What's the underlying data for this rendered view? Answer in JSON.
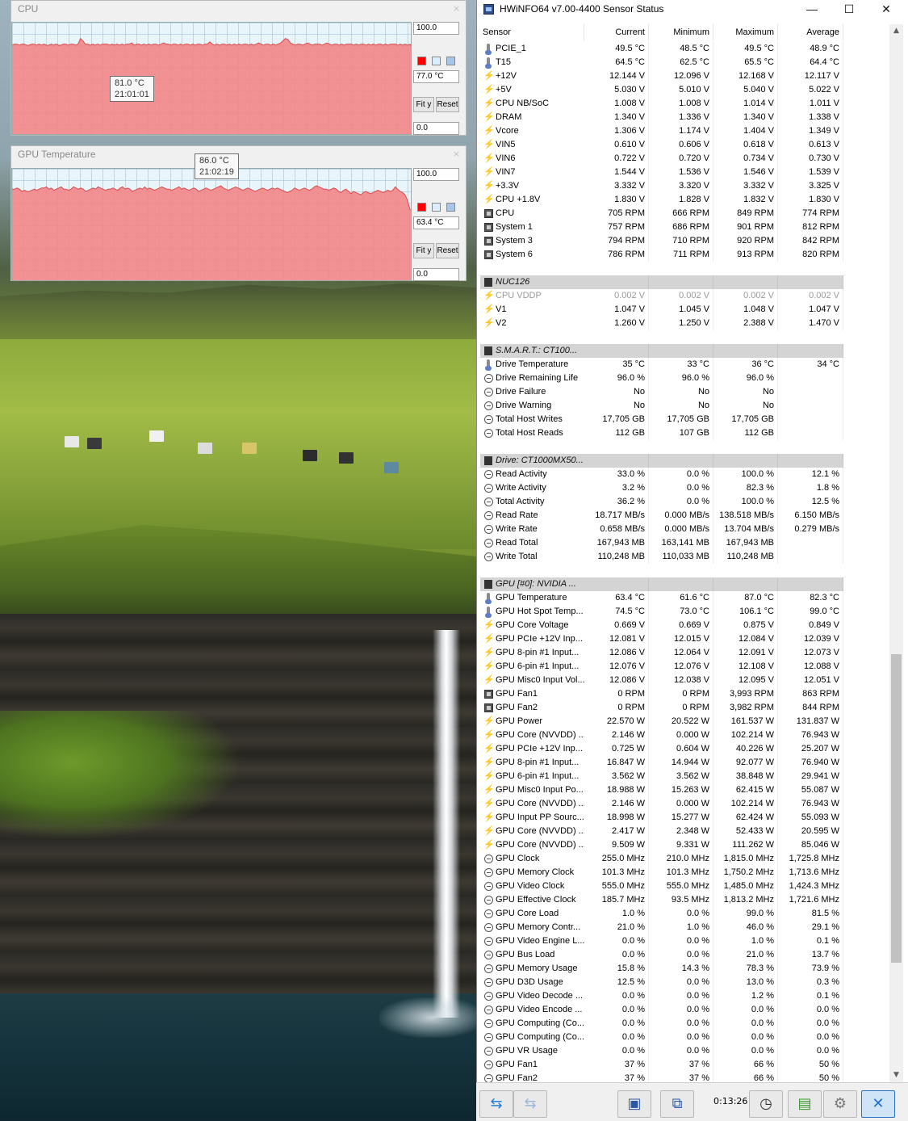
{
  "graphs": [
    {
      "title": "CPU",
      "close_label": "×",
      "max_label": "100.0",
      "current_label": "77.0 °C",
      "min_label": "0.0",
      "fit_label": "Fit y",
      "reset_label": "Reset",
      "tooltip_value": "81.0 °C",
      "tooltip_time": "21:01:01",
      "fill_color": "#f2888a",
      "line_color": "#d94a4a",
      "swatch_colors": [
        "#ff0000",
        "#ddeefa",
        "#a8c4e6"
      ],
      "ylim": [
        0,
        100
      ],
      "series": [
        80,
        81,
        81,
        80,
        81,
        81,
        80,
        80,
        81,
        81,
        80,
        81,
        80,
        81,
        80,
        80,
        81,
        80,
        81,
        80,
        80,
        81,
        81,
        80,
        81,
        81,
        80,
        81,
        86,
        84,
        81,
        81,
        80,
        81,
        80,
        81,
        80,
        81,
        81,
        81,
        80,
        81,
        80,
        81,
        80,
        81,
        80,
        81,
        81,
        82,
        80,
        81,
        81,
        80,
        81,
        80,
        81,
        80,
        81,
        81,
        80,
        81,
        82,
        81,
        81,
        80,
        81,
        81,
        80,
        81,
        80,
        81,
        81,
        80,
        81,
        80,
        81,
        81,
        80,
        81,
        81,
        83,
        81,
        80,
        81,
        80,
        81,
        81,
        80,
        81,
        80,
        81,
        80,
        81,
        80,
        81,
        81,
        80,
        81,
        80,
        81,
        82,
        81,
        80,
        81,
        81,
        80,
        81,
        80,
        81,
        82,
        84,
        86,
        85,
        82,
        81,
        80,
        81,
        81,
        80,
        81,
        82,
        81,
        80,
        81,
        81,
        81,
        80,
        81,
        82,
        81,
        80,
        81,
        81,
        80,
        81,
        80,
        81,
        81,
        81,
        80,
        81,
        80,
        81,
        81,
        80,
        81,
        80,
        81,
        80,
        81,
        81,
        80,
        81,
        80,
        81,
        81,
        81,
        80,
        81,
        80,
        81,
        80,
        81,
        77
      ]
    },
    {
      "title": "GPU Temperature",
      "close_label": "×",
      "max_label": "100.0",
      "current_label": "63.4 °C",
      "min_label": "0.0",
      "fit_label": "Fit y",
      "reset_label": "Reset",
      "tooltip_value": "86.0 °C",
      "tooltip_time": "21:02:19",
      "fill_color": "#f2888a",
      "line_color": "#d94a4a",
      "swatch_colors": [
        "#ff0000",
        "#ddeefa",
        "#a8c4e6"
      ],
      "ylim": [
        0,
        100
      ],
      "series": [
        82,
        82,
        83,
        82,
        80,
        81,
        80,
        80,
        81,
        82,
        81,
        82,
        83,
        83,
        84,
        82,
        83,
        81,
        82,
        83,
        84,
        82,
        82,
        81,
        82,
        84,
        83,
        82,
        83,
        82,
        80,
        81,
        82,
        83,
        82,
        84,
        83,
        82,
        81,
        82,
        82,
        83,
        82,
        81,
        83,
        84,
        82,
        83,
        82,
        80,
        81,
        82,
        83,
        82,
        84,
        82,
        83,
        82,
        81,
        82,
        83,
        84,
        83,
        82,
        82,
        81,
        82,
        83,
        84,
        82,
        83,
        82,
        81,
        82,
        83,
        82,
        80,
        81,
        82,
        83,
        82,
        81,
        82,
        83,
        84,
        85,
        83,
        82,
        81,
        82,
        83,
        84,
        83,
        82,
        81,
        82,
        83,
        82,
        81,
        80,
        81,
        82,
        83,
        82,
        81,
        82,
        83,
        82,
        83,
        82,
        81,
        80,
        79,
        80,
        81,
        83,
        82,
        81,
        82,
        83,
        82,
        81,
        82,
        84,
        85,
        84,
        83,
        82,
        82,
        81,
        82,
        83,
        82,
        80,
        79,
        81,
        82,
        80,
        78,
        80,
        79,
        78,
        77,
        79,
        80,
        79,
        78,
        79,
        80,
        81,
        80,
        79,
        80,
        81,
        80,
        81,
        84,
        82,
        80,
        79,
        77,
        72,
        64,
        63
      ]
    }
  ],
  "hwinfo": {
    "title": "HWiNFO64 v7.00-4400 Sensor Status",
    "controls": {
      "minimize": "—",
      "maximize": "☐",
      "close": "✕"
    },
    "columns": [
      "Sensor",
      "Current",
      "Minimum",
      "Maximum",
      "Average"
    ],
    "rows": [
      {
        "type": "sensor",
        "icon": "therm",
        "name": "PCIE_1",
        "cur": "49.5 °C",
        "min": "48.5 °C",
        "max": "49.5 °C",
        "avg": "48.9 °C"
      },
      {
        "type": "sensor",
        "icon": "therm",
        "name": "T15",
        "cur": "64.5 °C",
        "min": "62.5 °C",
        "max": "65.5 °C",
        "avg": "64.4 °C"
      },
      {
        "type": "sensor",
        "icon": "volt",
        "name": "+12V",
        "cur": "12.144 V",
        "min": "12.096 V",
        "max": "12.168 V",
        "avg": "12.117 V"
      },
      {
        "type": "sensor",
        "icon": "volt",
        "name": "+5V",
        "cur": "5.030 V",
        "min": "5.010 V",
        "max": "5.040 V",
        "avg": "5.022 V"
      },
      {
        "type": "sensor",
        "icon": "volt",
        "name": "CPU NB/SoC",
        "cur": "1.008 V",
        "min": "1.008 V",
        "max": "1.014 V",
        "avg": "1.011 V"
      },
      {
        "type": "sensor",
        "icon": "volt",
        "name": "DRAM",
        "cur": "1.340 V",
        "min": "1.336 V",
        "max": "1.340 V",
        "avg": "1.338 V"
      },
      {
        "type": "sensor",
        "icon": "volt",
        "name": "Vcore",
        "cur": "1.306 V",
        "min": "1.174 V",
        "max": "1.404 V",
        "avg": "1.349 V"
      },
      {
        "type": "sensor",
        "icon": "volt",
        "name": "VIN5",
        "cur": "0.610 V",
        "min": "0.606 V",
        "max": "0.618 V",
        "avg": "0.613 V"
      },
      {
        "type": "sensor",
        "icon": "volt",
        "name": "VIN6",
        "cur": "0.722 V",
        "min": "0.720 V",
        "max": "0.734 V",
        "avg": "0.730 V"
      },
      {
        "type": "sensor",
        "icon": "volt",
        "name": "VIN7",
        "cur": "1.544 V",
        "min": "1.536 V",
        "max": "1.546 V",
        "avg": "1.539 V"
      },
      {
        "type": "sensor",
        "icon": "volt",
        "name": "+3.3V",
        "cur": "3.332 V",
        "min": "3.320 V",
        "max": "3.332 V",
        "avg": "3.325 V"
      },
      {
        "type": "sensor",
        "icon": "volt",
        "name": "CPU +1.8V",
        "cur": "1.830 V",
        "min": "1.828 V",
        "max": "1.832 V",
        "avg": "1.830 V"
      },
      {
        "type": "sensor",
        "icon": "fan",
        "name": "CPU",
        "cur": "705 RPM",
        "min": "666 RPM",
        "max": "849 RPM",
        "avg": "774 RPM"
      },
      {
        "type": "sensor",
        "icon": "fan",
        "name": "System 1",
        "cur": "757 RPM",
        "min": "686 RPM",
        "max": "901 RPM",
        "avg": "812 RPM"
      },
      {
        "type": "sensor",
        "icon": "fan",
        "name": "System 3",
        "cur": "794 RPM",
        "min": "710 RPM",
        "max": "920 RPM",
        "avg": "842 RPM"
      },
      {
        "type": "sensor",
        "icon": "fan",
        "name": "System 6",
        "cur": "786 RPM",
        "min": "711 RPM",
        "max": "913 RPM",
        "avg": "820 RPM"
      },
      {
        "type": "blank"
      },
      {
        "type": "header",
        "name": "NUC126"
      },
      {
        "type": "sensor",
        "icon": "volt",
        "name": "CPU VDDP",
        "cur": "0.002 V",
        "min": "0.002 V",
        "max": "0.002 V",
        "avg": "0.002 V",
        "grey": true
      },
      {
        "type": "sensor",
        "icon": "volt",
        "name": "V1",
        "cur": "1.047 V",
        "min": "1.045 V",
        "max": "1.048 V",
        "avg": "1.047 V"
      },
      {
        "type": "sensor",
        "icon": "volt",
        "name": "V2",
        "cur": "1.260 V",
        "min": "1.250 V",
        "max": "2.388 V",
        "avg": "1.470 V"
      },
      {
        "type": "blank"
      },
      {
        "type": "header",
        "name": "S.M.A.R.T.: CT100..."
      },
      {
        "type": "sensor",
        "icon": "therm",
        "name": "Drive Temperature",
        "cur": "35 °C",
        "min": "33 °C",
        "max": "36 °C",
        "avg": "34 °C"
      },
      {
        "type": "sensor",
        "icon": "clock",
        "name": "Drive Remaining Life",
        "cur": "96.0 %",
        "min": "96.0 %",
        "max": "96.0 %",
        "avg": ""
      },
      {
        "type": "sensor",
        "icon": "clock",
        "name": "Drive Failure",
        "cur": "No",
        "min": "No",
        "max": "No",
        "avg": ""
      },
      {
        "type": "sensor",
        "icon": "clock",
        "name": "Drive Warning",
        "cur": "No",
        "min": "No",
        "max": "No",
        "avg": ""
      },
      {
        "type": "sensor",
        "icon": "clock",
        "name": "Total Host Writes",
        "cur": "17,705 GB",
        "min": "17,705 GB",
        "max": "17,705 GB",
        "avg": ""
      },
      {
        "type": "sensor",
        "icon": "clock",
        "name": "Total Host Reads",
        "cur": "112 GB",
        "min": "107 GB",
        "max": "112 GB",
        "avg": ""
      },
      {
        "type": "blank"
      },
      {
        "type": "header",
        "name": "Drive: CT1000MX50..."
      },
      {
        "type": "sensor",
        "icon": "clock",
        "name": "Read Activity",
        "cur": "33.0 %",
        "min": "0.0 %",
        "max": "100.0 %",
        "avg": "12.1 %"
      },
      {
        "type": "sensor",
        "icon": "clock",
        "name": "Write Activity",
        "cur": "3.2 %",
        "min": "0.0 %",
        "max": "82.3 %",
        "avg": "1.8 %"
      },
      {
        "type": "sensor",
        "icon": "clock",
        "name": "Total Activity",
        "cur": "36.2 %",
        "min": "0.0 %",
        "max": "100.0 %",
        "avg": "12.5 %"
      },
      {
        "type": "sensor",
        "icon": "clock",
        "name": "Read Rate",
        "cur": "18.717 MB/s",
        "min": "0.000 MB/s",
        "max": "138.518 MB/s",
        "avg": "6.150 MB/s"
      },
      {
        "type": "sensor",
        "icon": "clock",
        "name": "Write Rate",
        "cur": "0.658 MB/s",
        "min": "0.000 MB/s",
        "max": "13.704 MB/s",
        "avg": "0.279 MB/s"
      },
      {
        "type": "sensor",
        "icon": "clock",
        "name": "Read Total",
        "cur": "167,943 MB",
        "min": "163,141 MB",
        "max": "167,943 MB",
        "avg": ""
      },
      {
        "type": "sensor",
        "icon": "clock",
        "name": "Write Total",
        "cur": "110,248 MB",
        "min": "110,033 MB",
        "max": "110,248 MB",
        "avg": ""
      },
      {
        "type": "blank"
      },
      {
        "type": "header",
        "name": "GPU [#0]: NVIDIA ..."
      },
      {
        "type": "sensor",
        "icon": "therm",
        "name": "GPU Temperature",
        "cur": "63.4 °C",
        "min": "61.6 °C",
        "max": "87.0 °C",
        "avg": "82.3 °C"
      },
      {
        "type": "sensor",
        "icon": "therm",
        "name": "GPU Hot Spot Temp...",
        "cur": "74.5 °C",
        "min": "73.0 °C",
        "max": "106.1 °C",
        "avg": "99.0 °C"
      },
      {
        "type": "sensor",
        "icon": "volt",
        "name": "GPU Core Voltage",
        "cur": "0.669 V",
        "min": "0.669 V",
        "max": "0.875 V",
        "avg": "0.849 V"
      },
      {
        "type": "sensor",
        "icon": "volt",
        "name": "GPU PCIe +12V Inp...",
        "cur": "12.081 V",
        "min": "12.015 V",
        "max": "12.084 V",
        "avg": "12.039 V"
      },
      {
        "type": "sensor",
        "icon": "volt",
        "name": "GPU 8-pin #1 Input...",
        "cur": "12.086 V",
        "min": "12.064 V",
        "max": "12.091 V",
        "avg": "12.073 V"
      },
      {
        "type": "sensor",
        "icon": "volt",
        "name": "GPU 6-pin #1 Input...",
        "cur": "12.076 V",
        "min": "12.076 V",
        "max": "12.108 V",
        "avg": "12.088 V"
      },
      {
        "type": "sensor",
        "icon": "volt",
        "name": "GPU Misc0 Input Vol...",
        "cur": "12.086 V",
        "min": "12.038 V",
        "max": "12.095 V",
        "avg": "12.051 V"
      },
      {
        "type": "sensor",
        "icon": "fan",
        "name": "GPU Fan1",
        "cur": "0 RPM",
        "min": "0 RPM",
        "max": "3,993 RPM",
        "avg": "863 RPM"
      },
      {
        "type": "sensor",
        "icon": "fan",
        "name": "GPU Fan2",
        "cur": "0 RPM",
        "min": "0 RPM",
        "max": "3,982 RPM",
        "avg": "844 RPM"
      },
      {
        "type": "sensor",
        "icon": "volt",
        "name": "GPU Power",
        "cur": "22.570 W",
        "min": "20.522 W",
        "max": "161.537 W",
        "avg": "131.837 W"
      },
      {
        "type": "sensor",
        "icon": "volt",
        "name": "GPU Core (NVVDD) ...",
        "cur": "2.146 W",
        "min": "0.000 W",
        "max": "102.214 W",
        "avg": "76.943 W"
      },
      {
        "type": "sensor",
        "icon": "volt",
        "name": "GPU PCIe +12V Inp...",
        "cur": "0.725 W",
        "min": "0.604 W",
        "max": "40.226 W",
        "avg": "25.207 W"
      },
      {
        "type": "sensor",
        "icon": "volt",
        "name": "GPU 8-pin #1 Input...",
        "cur": "16.847 W",
        "min": "14.944 W",
        "max": "92.077 W",
        "avg": "76.940 W"
      },
      {
        "type": "sensor",
        "icon": "volt",
        "name": "GPU 6-pin #1 Input...",
        "cur": "3.562 W",
        "min": "3.562 W",
        "max": "38.848 W",
        "avg": "29.941 W"
      },
      {
        "type": "sensor",
        "icon": "volt",
        "name": "GPU Misc0 Input Po...",
        "cur": "18.988 W",
        "min": "15.263 W",
        "max": "62.415 W",
        "avg": "55.087 W"
      },
      {
        "type": "sensor",
        "icon": "volt",
        "name": "GPU Core (NVVDD) ...",
        "cur": "2.146 W",
        "min": "0.000 W",
        "max": "102.214 W",
        "avg": "76.943 W"
      },
      {
        "type": "sensor",
        "icon": "volt",
        "name": "GPU Input PP Sourc...",
        "cur": "18.998 W",
        "min": "15.277 W",
        "max": "62.424 W",
        "avg": "55.093 W"
      },
      {
        "type": "sensor",
        "icon": "volt",
        "name": "GPU Core (NVVDD) ...",
        "cur": "2.417 W",
        "min": "2.348 W",
        "max": "52.433 W",
        "avg": "20.595 W"
      },
      {
        "type": "sensor",
        "icon": "volt",
        "name": "GPU Core (NVVDD) ...",
        "cur": "9.509 W",
        "min": "9.331 W",
        "max": "111.262 W",
        "avg": "85.046 W"
      },
      {
        "type": "sensor",
        "icon": "clock",
        "name": "GPU Clock",
        "cur": "255.0 MHz",
        "min": "210.0 MHz",
        "max": "1,815.0 MHz",
        "avg": "1,725.8 MHz"
      },
      {
        "type": "sensor",
        "icon": "clock",
        "name": "GPU Memory Clock",
        "cur": "101.3 MHz",
        "min": "101.3 MHz",
        "max": "1,750.2 MHz",
        "avg": "1,713.6 MHz"
      },
      {
        "type": "sensor",
        "icon": "clock",
        "name": "GPU Video Clock",
        "cur": "555.0 MHz",
        "min": "555.0 MHz",
        "max": "1,485.0 MHz",
        "avg": "1,424.3 MHz"
      },
      {
        "type": "sensor",
        "icon": "clock",
        "name": "GPU Effective Clock",
        "cur": "185.7 MHz",
        "min": "93.5 MHz",
        "max": "1,813.2 MHz",
        "avg": "1,721.6 MHz"
      },
      {
        "type": "sensor",
        "icon": "clock",
        "name": "GPU Core Load",
        "cur": "1.0 %",
        "min": "0.0 %",
        "max": "99.0 %",
        "avg": "81.5 %"
      },
      {
        "type": "sensor",
        "icon": "clock",
        "name": "GPU Memory Contr...",
        "cur": "21.0 %",
        "min": "1.0 %",
        "max": "46.0 %",
        "avg": "29.1 %"
      },
      {
        "type": "sensor",
        "icon": "clock",
        "name": "GPU Video Engine L...",
        "cur": "0.0 %",
        "min": "0.0 %",
        "max": "1.0 %",
        "avg": "0.1 %"
      },
      {
        "type": "sensor",
        "icon": "clock",
        "name": "GPU Bus Load",
        "cur": "0.0 %",
        "min": "0.0 %",
        "max": "21.0 %",
        "avg": "13.7 %"
      },
      {
        "type": "sensor",
        "icon": "clock",
        "name": "GPU Memory Usage",
        "cur": "15.8 %",
        "min": "14.3 %",
        "max": "78.3 %",
        "avg": "73.9 %"
      },
      {
        "type": "sensor",
        "icon": "clock",
        "name": "GPU D3D Usage",
        "cur": "12.5 %",
        "min": "0.0 %",
        "max": "13.0 %",
        "avg": "0.3 %"
      },
      {
        "type": "sensor",
        "icon": "clock",
        "name": "GPU Video Decode ...",
        "cur": "0.0 %",
        "min": "0.0 %",
        "max": "1.2 %",
        "avg": "0.1 %"
      },
      {
        "type": "sensor",
        "icon": "clock",
        "name": "GPU Video Encode ...",
        "cur": "0.0 %",
        "min": "0.0 %",
        "max": "0.0 %",
        "avg": "0.0 %"
      },
      {
        "type": "sensor",
        "icon": "clock",
        "name": "GPU Computing (Co...",
        "cur": "0.0 %",
        "min": "0.0 %",
        "max": "0.0 %",
        "avg": "0.0 %"
      },
      {
        "type": "sensor",
        "icon": "clock",
        "name": "GPU Computing (Co...",
        "cur": "0.0 %",
        "min": "0.0 %",
        "max": "0.0 %",
        "avg": "0.0 %"
      },
      {
        "type": "sensor",
        "icon": "clock",
        "name": "GPU VR Usage",
        "cur": "0.0 %",
        "min": "0.0 %",
        "max": "0.0 %",
        "avg": "0.0 %"
      },
      {
        "type": "sensor",
        "icon": "clock",
        "name": "GPU Fan1",
        "cur": "37 %",
        "min": "37 %",
        "max": "66 %",
        "avg": "50 %"
      },
      {
        "type": "sensor",
        "icon": "clock",
        "name": "GPU Fan2",
        "cur": "37 %",
        "min": "37 %",
        "max": "66 %",
        "avg": "50 %"
      }
    ],
    "timer": "0:13:26",
    "toolbar_icons": [
      "navigate-arrows-icon",
      "navigate-arrows-disabled-icon",
      "monitor-report-icon",
      "network-icon",
      "clock-icon",
      "add-report-icon",
      "settings-gear-icon",
      "close-x-icon"
    ]
  }
}
